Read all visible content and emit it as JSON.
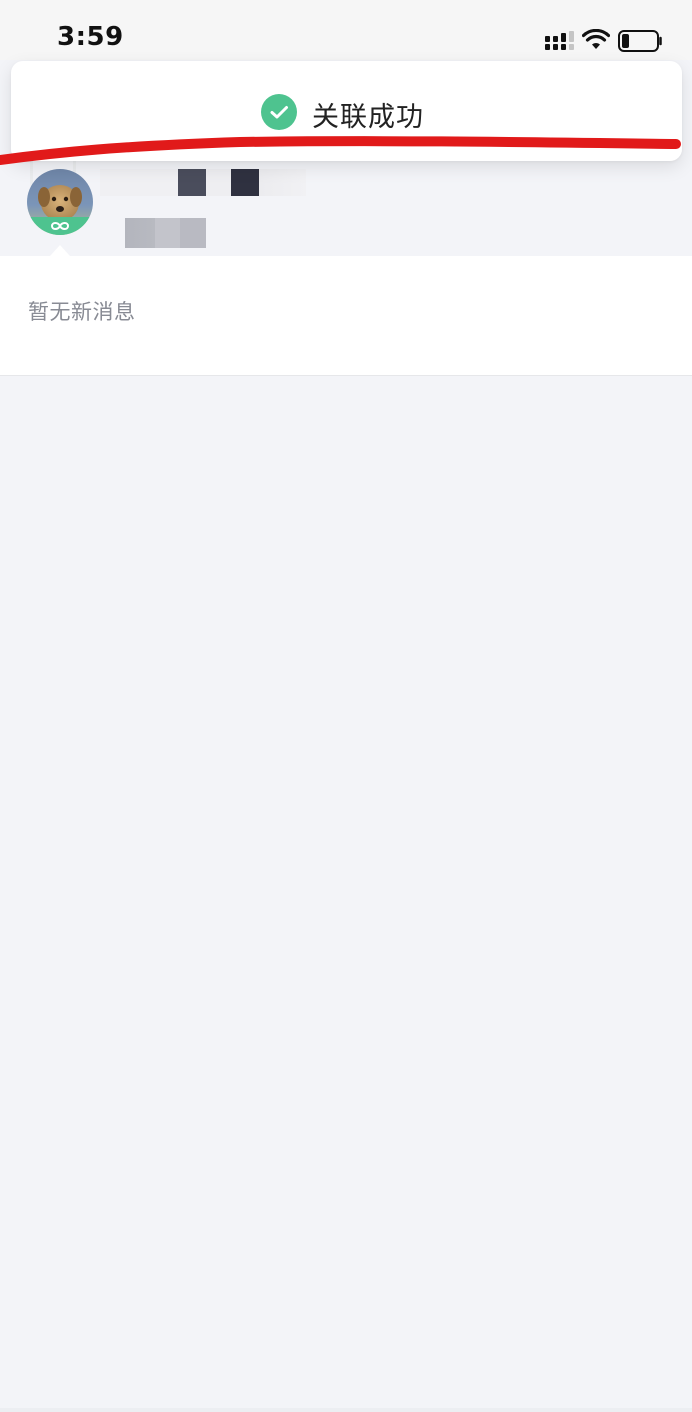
{
  "status_bar": {
    "time": "3:59",
    "icons": [
      "signal-icon",
      "wifi-icon",
      "battery-icon"
    ]
  },
  "toast": {
    "message": "关联成功",
    "icon": "check-circle-icon",
    "icon_color": "#4ec38f"
  },
  "profile": {
    "avatar": "dog-avatar",
    "badge_icon": "infinity-link-icon",
    "badge_color": "#4ec38f"
  },
  "messages": {
    "empty_text": "暂无新消息"
  },
  "colors": {
    "page_background": "#f3f4f8",
    "annotation": "#e11a1a"
  }
}
